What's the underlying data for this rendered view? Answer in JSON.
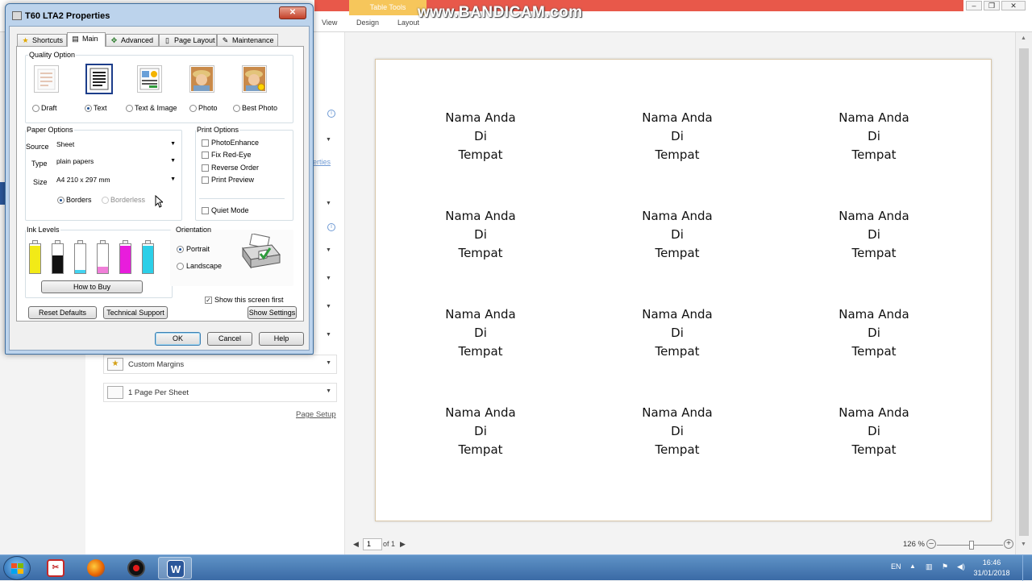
{
  "word": {
    "context_tab": "Table Tools",
    "ribbon_tabs": [
      "View",
      "Design",
      "Layout"
    ],
    "watermark": "www.BANDICAM.com",
    "partial_link": "erties",
    "settings": [
      {
        "label": "Custom Margins"
      },
      {
        "label": "1 Page Per Sheet"
      }
    ],
    "page_setup": "Page Setup",
    "labels": {
      "line1": "Nama Anda",
      "line2": "Di",
      "line3": "Tempat"
    },
    "status": {
      "page_current": "1",
      "page_of": "of 1",
      "zoom": "126 %",
      "zoom_level": 126
    }
  },
  "taskbar": {
    "language": "EN",
    "time": "16:46",
    "date": "31/01/2018"
  },
  "dialog": {
    "title": "T60 LTA2 Properties",
    "close": "✕",
    "tabs": [
      "Shortcuts",
      "Main",
      "Advanced",
      "Page Layout",
      "Maintenance"
    ],
    "selected_tab": "Main",
    "quality": {
      "title": "Quality Option",
      "options": [
        "Draft",
        "Text",
        "Text & Image",
        "Photo",
        "Best Photo"
      ],
      "selected": "Text"
    },
    "paper": {
      "title": "Paper Options",
      "source_label": "Source",
      "source_value": "Sheet",
      "type_label": "Type",
      "type_value": "plain papers",
      "size_label": "Size",
      "size_value": "A4 210 x 297 mm",
      "borders": "Borders",
      "borderless": "Borderless"
    },
    "print_options": {
      "title": "Print Options",
      "items": [
        "PhotoEnhance",
        "Fix Red-Eye",
        "Reverse Order",
        "Print Preview"
      ],
      "quiet_mode": "Quiet Mode"
    },
    "ink": {
      "title": "Ink Levels",
      "colors": [
        "#f2ea17",
        "#111111",
        "#43d3f0",
        "#f07ed8",
        "#e81ddc",
        "#2ccfe8"
      ],
      "levels": [
        0.95,
        0.6,
        0.12,
        0.22,
        0.95,
        0.95
      ],
      "how_to_buy": "How to Buy"
    },
    "orientation": {
      "title": "Orientation",
      "portrait": "Portrait",
      "landscape": "Landscape"
    },
    "show_first": "Show this screen first",
    "buttons": {
      "reset": "Reset Defaults",
      "support": "Technical Support",
      "show_settings": "Show Settings",
      "ok": "OK",
      "cancel": "Cancel",
      "help": "Help"
    }
  }
}
